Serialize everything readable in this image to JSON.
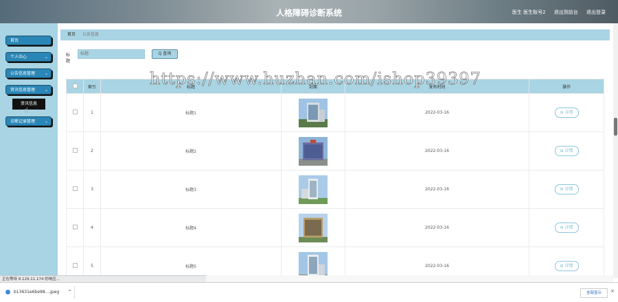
{
  "header": {
    "title": "人格障碍诊断系统",
    "user": "医生 医生账号2",
    "back_label": "退出到前台",
    "logout_label": "退出登录"
  },
  "sidebar": {
    "items": [
      {
        "label": "首页",
        "chevron": false
      },
      {
        "label": "个人中心",
        "chevron": true
      },
      {
        "label": "公告信息管理",
        "chevron": true
      },
      {
        "label": "资讯信息管理",
        "chevron": true
      },
      {
        "label": "诊断记录管理",
        "chevron": true
      }
    ],
    "submenu_label": "资讯信息"
  },
  "breadcrumb": {
    "home": "首页",
    "current": "公告信息"
  },
  "search": {
    "label": "标题",
    "placeholder": "标题",
    "button": "Q 查询"
  },
  "table": {
    "headers": [
      "索引",
      "标题",
      "封面",
      "发布时间",
      "操作"
    ],
    "rows": [
      {
        "index": "1",
        "title": "标题1",
        "date": "2022-03-16",
        "action": "⊞ 详情"
      },
      {
        "index": "2",
        "title": "标题2",
        "date": "2022-03-16",
        "action": "⊞ 详情"
      },
      {
        "index": "3",
        "title": "标题3",
        "date": "2022-03-16",
        "action": "⊞ 详情"
      },
      {
        "index": "4",
        "title": "标题4",
        "date": "2022-03-16",
        "action": "⊞ 详情"
      },
      {
        "index": "5",
        "title": "标题5",
        "date": "2022-03-16",
        "action": "⊞ 详情"
      }
    ]
  },
  "status_bar": "正在等待 8.129.11.174 的响应...",
  "download": {
    "file": "b13631e6be98....jpeg",
    "arrow": "^",
    "show_all": "全部显示",
    "close": "×"
  },
  "watermark": "https://www.huzhan.com/ishop39397",
  "colors": {
    "accent": "#a9d4e3",
    "menu": "#2a86b6"
  }
}
